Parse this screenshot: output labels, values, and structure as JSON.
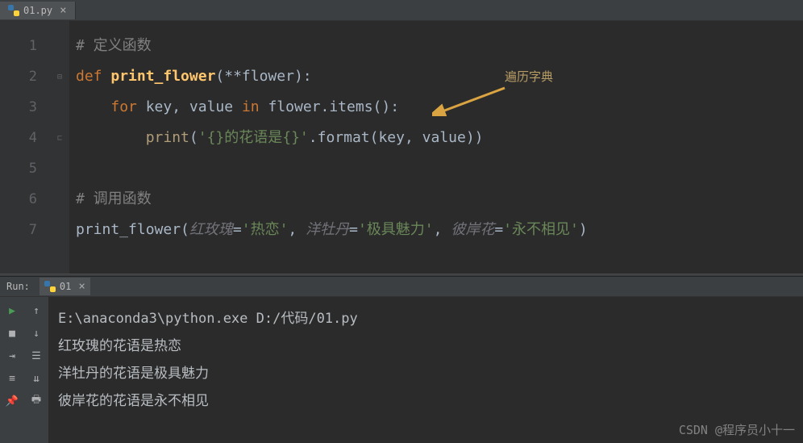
{
  "tab": {
    "filename": "01.py"
  },
  "editor": {
    "lineNumbers": [
      "1",
      "2",
      "3",
      "4",
      "5",
      "6",
      "7"
    ],
    "annotation": "遍历字典",
    "code": {
      "l1_comment": "# 定义函数",
      "l2_def": "def",
      "l2_name": "print_flower",
      "l2_params": "**flower",
      "l3_for": "for",
      "l3_key": "key",
      "l3_comma": ", ",
      "l3_value": "value",
      "l3_in": "in",
      "l3_flower": "flower.items():",
      "l4_print": "print",
      "l4_str": "'{}的花语是{}'",
      "l4_format": ".format(key, value))",
      "l6_comment": "# 调用函数",
      "l7_call": "print_flower",
      "l7_k1": "红玫瑰",
      "l7_v1": "'热恋'",
      "l7_k2": "洋牡丹",
      "l7_v2": "'极具魅力'",
      "l7_k3": "彼岸花",
      "l7_v3": "'永不相见'"
    }
  },
  "run": {
    "label": "Run:",
    "config": "01"
  },
  "console": {
    "cmd": "E:\\anaconda3\\python.exe D:/代码/01.py",
    "out1": "红玫瑰的花语是热恋",
    "out2": "洋牡丹的花语是极具魅力",
    "out3": "彼岸花的花语是永不相见"
  },
  "watermark": "CSDN @程序员小十一"
}
